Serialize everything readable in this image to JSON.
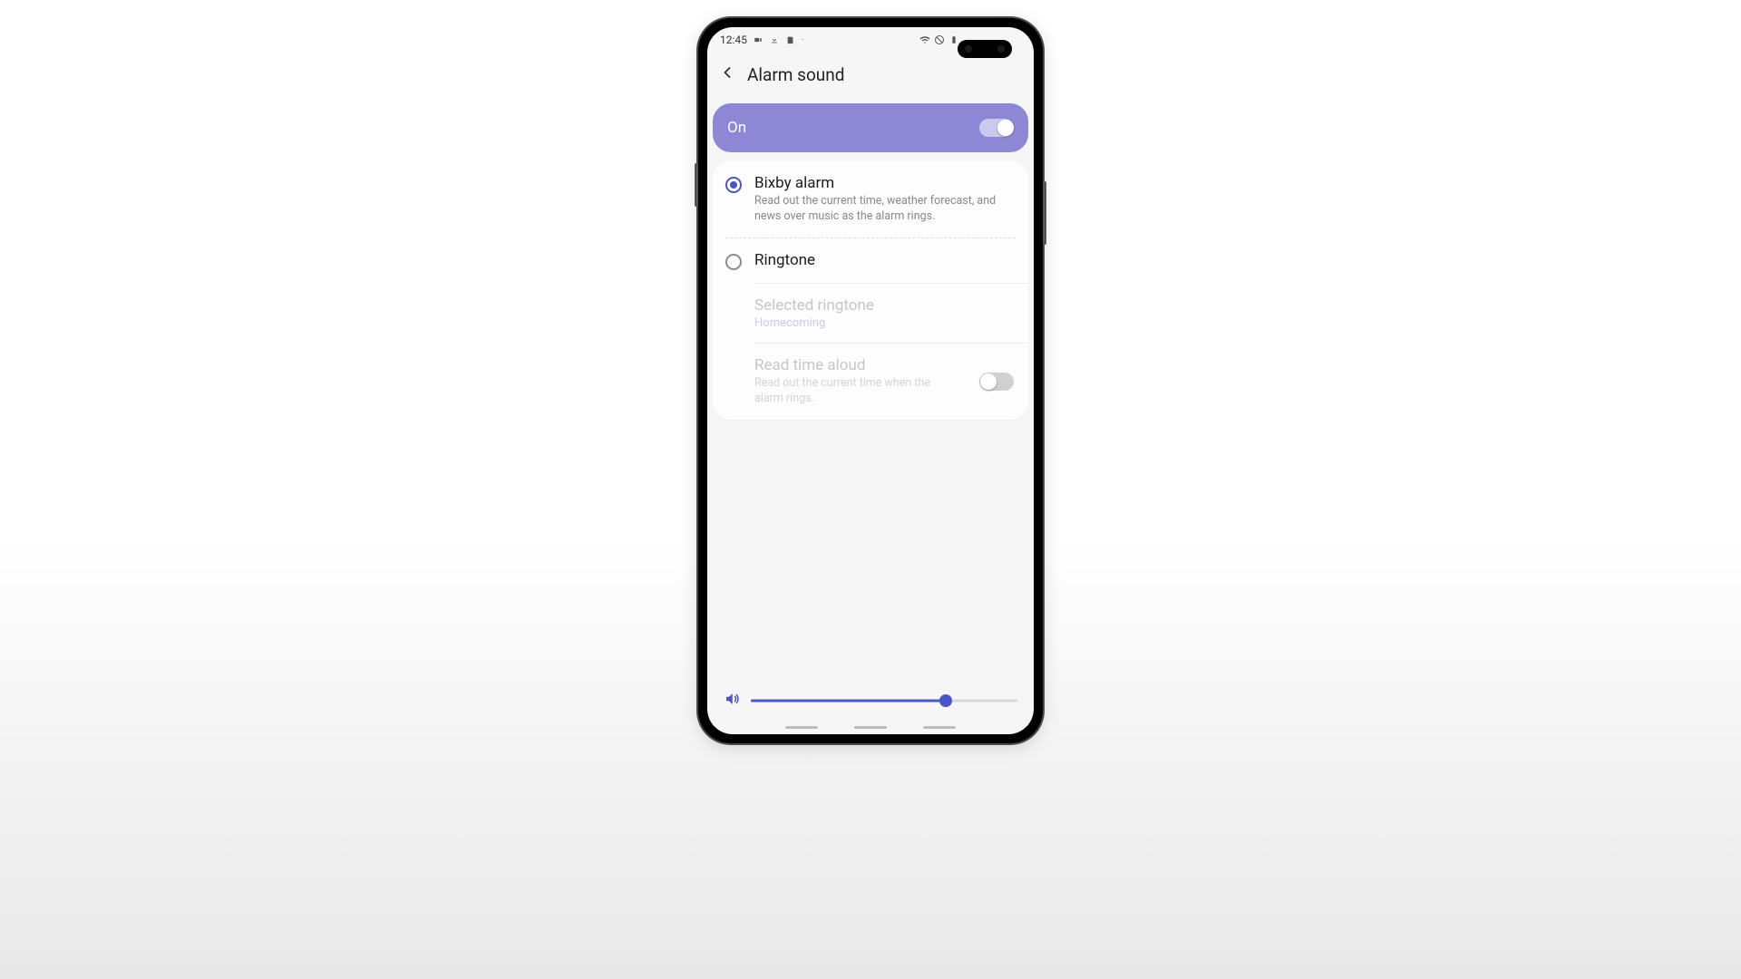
{
  "status": {
    "time": "12:45"
  },
  "header": {
    "title": "Alarm sound"
  },
  "master": {
    "label": "On",
    "enabled": true
  },
  "options": {
    "bixby": {
      "title": "Bixby alarm",
      "subtitle": "Read out the current time, weather forecast, and news over music as the alarm rings.",
      "selected": true
    },
    "ringtone": {
      "title": "Ringtone",
      "selected": false,
      "selected_label": "Selected ringtone",
      "selected_value": "Homecoming"
    },
    "read_time": {
      "title": "Read time aloud",
      "subtitle": "Read out the current time when the alarm rings.",
      "enabled": false
    }
  },
  "volume": {
    "percent": 73
  },
  "colors": {
    "accent": "#4a55c9",
    "banner": "#8d87d6"
  }
}
